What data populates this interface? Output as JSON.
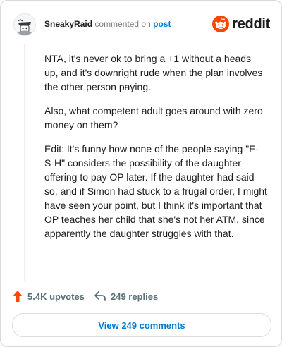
{
  "comment": {
    "username": "SneakyRaid",
    "commented_text": "commented on",
    "post_link": "post",
    "paragraphs": [
      "NTA, it's never ok to bring a +1 without a heads up, and it's downright rude when the plan involves the other person paying.",
      "Also, what competent adult goes around with zero money on them?",
      "Edit: It's funny how none of the people saying \"E-S-H\" considers the possibility of the daughter offering to pay OP later. If the daughter had said so, and if Simon had stuck to a frugal order, I might have seen your point, but I think it's important that OP teaches her child that she's not her ATM, since apparently the daughter struggles with that."
    ]
  },
  "brand": {
    "wordmark": "reddit",
    "icon": "reddit-snoo-icon",
    "color": "#ff4500"
  },
  "stats": {
    "upvotes_label": "5.4K upvotes",
    "upvote_icon": "upvote-arrow-icon",
    "upvote_color": "#ff4500",
    "replies_label": "249 replies",
    "reply_icon": "reply-arrow-icon"
  },
  "footer": {
    "view_button_label": "View 249 comments"
  },
  "avatar": {
    "icon": "user-avatar-icon"
  }
}
